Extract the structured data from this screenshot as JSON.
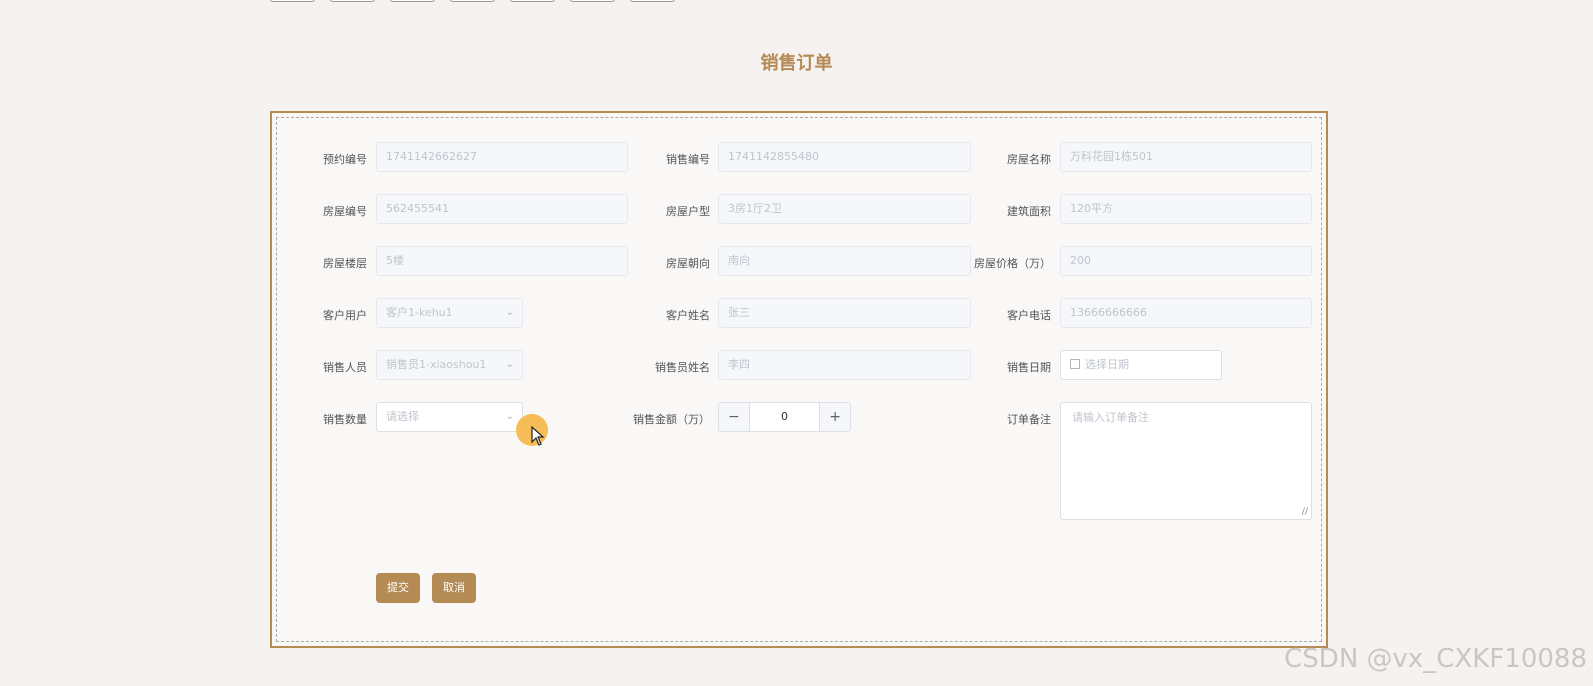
{
  "title": "销售订单",
  "row1": {
    "booking_no_label": "预约编号",
    "booking_no_value": "1741142662627",
    "sale_no_label": "销售编号",
    "sale_no_value": "1741142855480",
    "house_name_label": "房屋名称",
    "house_name_value": "万科花园1栋501"
  },
  "row2": {
    "house_no_label": "房屋编号",
    "house_no_value": "562455541",
    "house_type_label": "房屋户型",
    "house_type_value": "3房1厅2卫",
    "area_label": "建筑面积",
    "area_value": "120平方"
  },
  "row3": {
    "floor_label": "房屋楼层",
    "floor_value": "5楼",
    "orientation_label": "房屋朝向",
    "orientation_value": "南向",
    "price_label": "房屋价格（万）",
    "price_value": "200"
  },
  "row4": {
    "customer_user_label": "客户用户",
    "customer_user_value": "客户1-kehu1",
    "customer_name_label": "客户姓名",
    "customer_name_value": "张三",
    "customer_phone_label": "客户电话",
    "customer_phone_value": "13666666666"
  },
  "row5": {
    "salesperson_label": "销售人员",
    "salesperson_value": "销售员1-xiaoshou1",
    "salesperson_name_label": "销售员姓名",
    "salesperson_name_value": "李四",
    "sale_date_label": "销售日期",
    "sale_date_placeholder": "选择日期"
  },
  "row6": {
    "quantity_label": "销售数量",
    "quantity_placeholder": "请选择",
    "amount_label": "销售金额（万）",
    "amount_value": "0",
    "remark_label": "订单备注",
    "remark_placeholder": "请输入订单备注"
  },
  "buttons": {
    "submit": "提交",
    "cancel": "取消"
  },
  "watermark": "CSDN @vx_CXKF10088",
  "colors": {
    "accent": "#b48a55",
    "background": "#f5f2ef"
  },
  "icons": [
    "chevron-down-icon",
    "calendar-icon",
    "minus-icon",
    "plus-icon",
    "resize-handle-icon",
    "mouse-cursor-icon"
  ]
}
